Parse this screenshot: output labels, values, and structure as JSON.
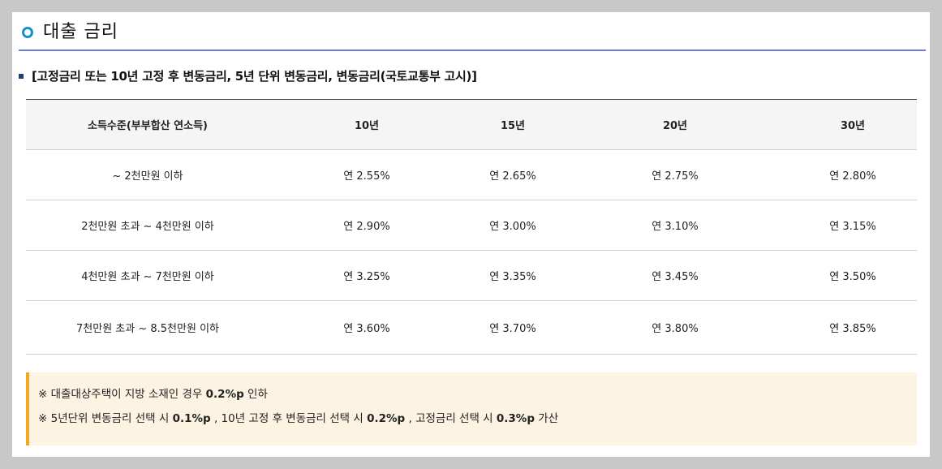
{
  "section": {
    "title": "대출 금리"
  },
  "subheading": "[고정금리 또는 10년 고정 후 변동금리, 5년 단위 변동금리, 변동금리(국토교통부 고시)]",
  "table": {
    "headers": [
      "소득수준(부부합산 연소득)",
      "10년",
      "15년",
      "20년",
      "30년"
    ],
    "rows": [
      [
        "~ 2천만원 이하",
        "연 2.55%",
        "연 2.65%",
        "연 2.75%",
        "연 2.80%"
      ],
      [
        "2천만원 초과 ~ 4천만원 이하",
        "연 2.90%",
        "연 3.00%",
        "연 3.10%",
        "연 3.15%"
      ],
      [
        "4천만원 초과 ~ 7천만원 이하",
        "연 3.25%",
        "연 3.35%",
        "연 3.45%",
        "연 3.50%"
      ],
      [
        "7천만원 초과 ~ 8.5천만원 이하",
        "연 3.60%",
        "연 3.70%",
        "연 3.80%",
        "연 3.85%"
      ]
    ]
  },
  "notes": {
    "line1": {
      "prefix": "※ 대출대상주택이 지방 소재인 경우 ",
      "bold": "0.2%p",
      "suffix": " 인하"
    },
    "line2": {
      "p1": "※ 5년단위 변동금리 선택 시 ",
      "b1": "0.1%p",
      "p2": " , 10년 고정 후 변동금리 선택 시 ",
      "b2": "0.2%p",
      "p3": " , 고정금리 선택 시 ",
      "b3": "0.3%p",
      "p4": " 가산"
    }
  },
  "colors": {
    "accent_ring": "#1a8fd0",
    "heading_rule": "#6b7fd6",
    "note_bar": "#f5a623",
    "note_bg": "#fdf3e3"
  }
}
